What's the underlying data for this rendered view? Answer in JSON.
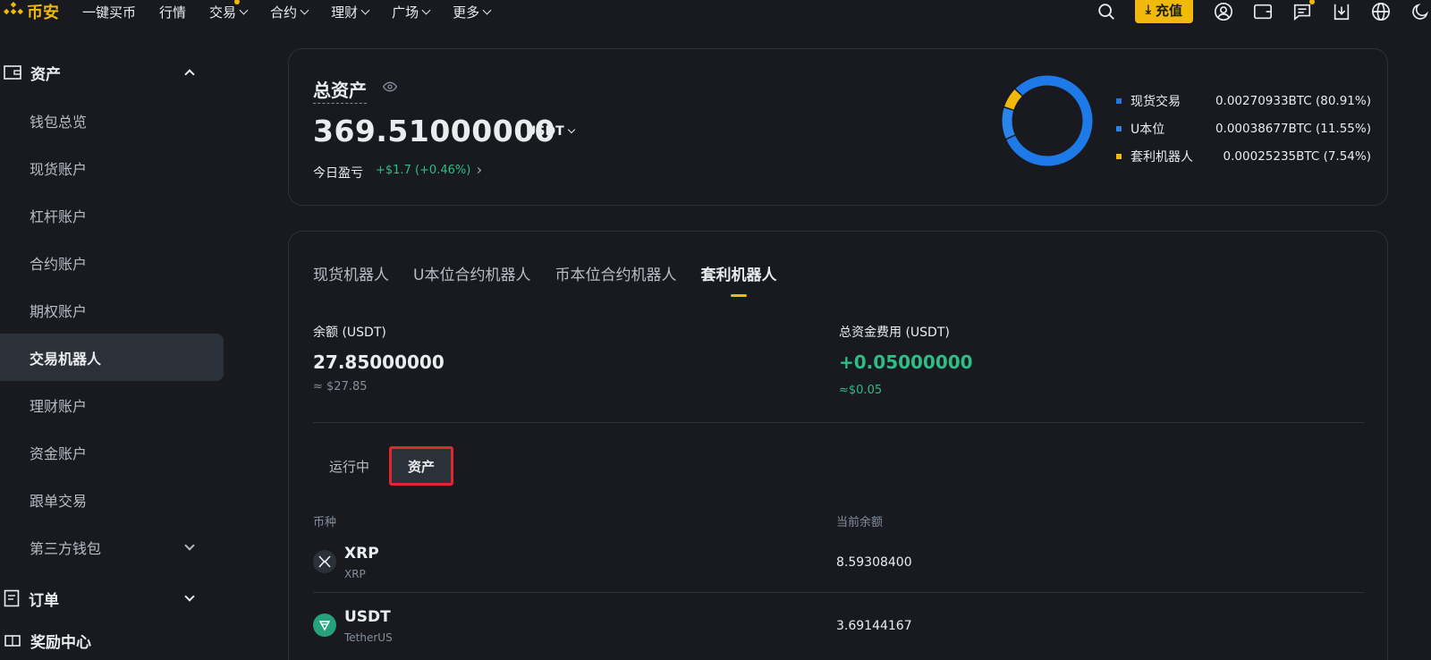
{
  "brand": {
    "name": "币安",
    "color": "#f0b90b"
  },
  "nav": {
    "items": [
      {
        "label": "一键买币",
        "dropdown": false
      },
      {
        "label": "行情",
        "dropdown": false
      },
      {
        "label": "交易",
        "dropdown": true
      },
      {
        "label": "合约",
        "dropdown": true
      },
      {
        "label": "理财",
        "dropdown": true
      },
      {
        "label": "广场",
        "dropdown": true
      },
      {
        "label": "更多",
        "dropdown": true
      }
    ],
    "deposit_label": "充值",
    "icons": [
      "search-icon",
      "user-icon",
      "wallet-icon",
      "message-icon",
      "download-icon",
      "globe-icon",
      "moon-icon"
    ]
  },
  "sidebar": {
    "assets_label": "资产",
    "items": [
      {
        "label": "钱包总览"
      },
      {
        "label": "现货账户"
      },
      {
        "label": "杠杆账户"
      },
      {
        "label": "合约账户"
      },
      {
        "label": "期权账户"
      },
      {
        "label": "交易机器人",
        "active": true
      },
      {
        "label": "理财账户"
      },
      {
        "label": "资金账户"
      },
      {
        "label": "跟单交易"
      },
      {
        "label": "第三方钱包",
        "expandable": true
      }
    ],
    "orders_label": "订单",
    "rewards_label": "奖励中心"
  },
  "overview": {
    "title": "总资产",
    "total_value": "369.51000000",
    "currency": "USDT",
    "pnl_label": "今日盈亏",
    "pnl_value": "+$1.7 (+0.46%)",
    "legend": [
      {
        "name": "现货交易",
        "value": "0.00270933BTC (80.91%)",
        "color": "#1e7ae8",
        "percent": 80.91
      },
      {
        "name": "U本位",
        "value": "0.00038677BTC (11.55%)",
        "color": "#2b84ec",
        "percent": 11.55
      },
      {
        "name": "套利机器人",
        "value": "0.00025235BTC (7.54%)",
        "color": "#f0b90b",
        "percent": 7.54
      }
    ]
  },
  "bots": {
    "tabs": [
      {
        "label": "现货机器人",
        "active": false
      },
      {
        "label": "U本位合约机器人",
        "active": false
      },
      {
        "label": "币本位合约机器人",
        "active": false
      },
      {
        "label": "套利机器人",
        "active": true
      }
    ],
    "balance_label": "余额 (USDT)",
    "balance_value": "27.85000000",
    "balance_sub": "≈ $27.85",
    "funding_label": "总资金费用 (USDT)",
    "funding_value": "+0.05000000",
    "funding_sub": "≈$0.05",
    "subtabs": {
      "running": "运行中",
      "assets": "资产"
    },
    "columns": {
      "coin": "币种",
      "balance": "当前余额"
    },
    "rows": [
      {
        "symbol": "XRP",
        "name": "XRP",
        "balance": "8.59308400",
        "icon": "xrp-icon"
      },
      {
        "symbol": "USDT",
        "name": "TetherUS",
        "balance": "3.69144167",
        "icon": "usdt-icon"
      }
    ]
  }
}
